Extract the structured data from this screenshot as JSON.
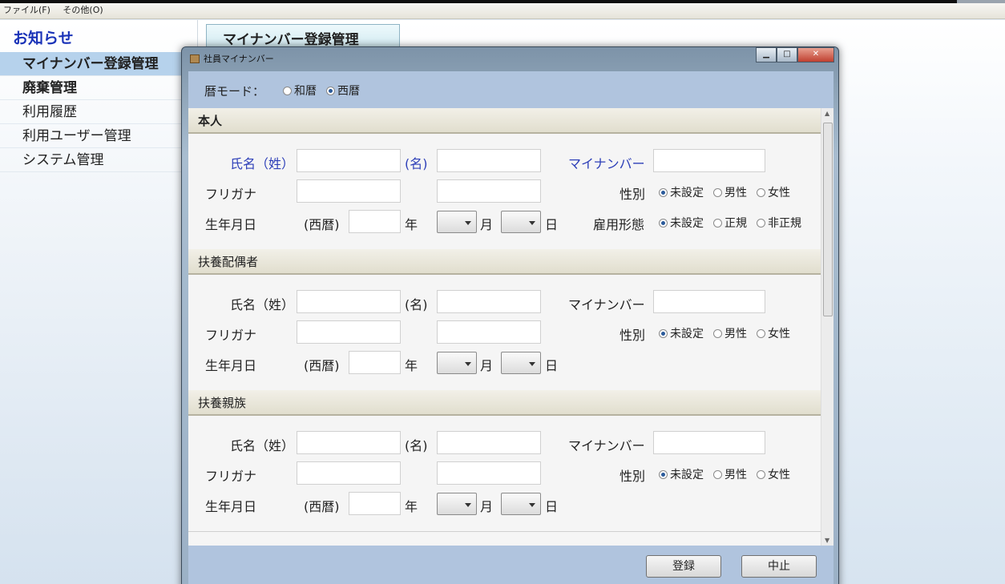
{
  "menubar": {
    "file": "ファイル(F)",
    "other": "その他(O)"
  },
  "nav": {
    "title": "お知らせ",
    "items": [
      {
        "label": "マイナンバー登録管理"
      },
      {
        "label": "廃棄管理"
      },
      {
        "label": "利用履歴"
      },
      {
        "label": "利用ユーザー管理"
      },
      {
        "label": "システム管理"
      }
    ]
  },
  "bg_tab": {
    "label": "マイナンバー登録管理"
  },
  "dialog": {
    "title": "社員マイナンバー",
    "window_buttons": {
      "minimize": "▁",
      "maximize": "□",
      "close": "✕"
    },
    "calendar_mode": {
      "label": "暦モード：",
      "options": [
        "和暦",
        "西暦"
      ],
      "selected": "西暦"
    },
    "sections": [
      {
        "heading": "本人",
        "surname_label": "氏名（姓）",
        "given_label": "(名)",
        "mynumber_label": "マイナンバー",
        "furigana_label": "フリガナ",
        "gender_label": "性別",
        "gender_options": [
          "未設定",
          "男性",
          "女性"
        ],
        "gender_selected": "未設定",
        "birth_label": "生年月日",
        "era": "(西暦)",
        "year_unit": "年",
        "month_unit": "月",
        "day_unit": "日",
        "employment_label": "雇用形態",
        "employment_options": [
          "未設定",
          "正規",
          "非正規"
        ],
        "employment_selected": "未設定"
      },
      {
        "heading": "扶養配偶者",
        "surname_label": "氏名（姓）",
        "given_label": "(名)",
        "mynumber_label": "マイナンバー",
        "furigana_label": "フリガナ",
        "gender_label": "性別",
        "gender_options": [
          "未設定",
          "男性",
          "女性"
        ],
        "gender_selected": "未設定",
        "birth_label": "生年月日",
        "era": "(西暦)",
        "year_unit": "年",
        "month_unit": "月",
        "day_unit": "日"
      },
      {
        "heading": "扶養親族",
        "surname_label": "氏名（姓）",
        "given_label": "(名)",
        "mynumber_label": "マイナンバー",
        "furigana_label": "フリガナ",
        "gender_label": "性別",
        "gender_options": [
          "未設定",
          "男性",
          "女性"
        ],
        "gender_selected": "未設定",
        "birth_label": "生年月日",
        "era": "(西暦)",
        "year_unit": "年",
        "month_unit": "月",
        "day_unit": "日"
      }
    ],
    "buttons": {
      "register": "登録",
      "cancel": "中止"
    }
  }
}
